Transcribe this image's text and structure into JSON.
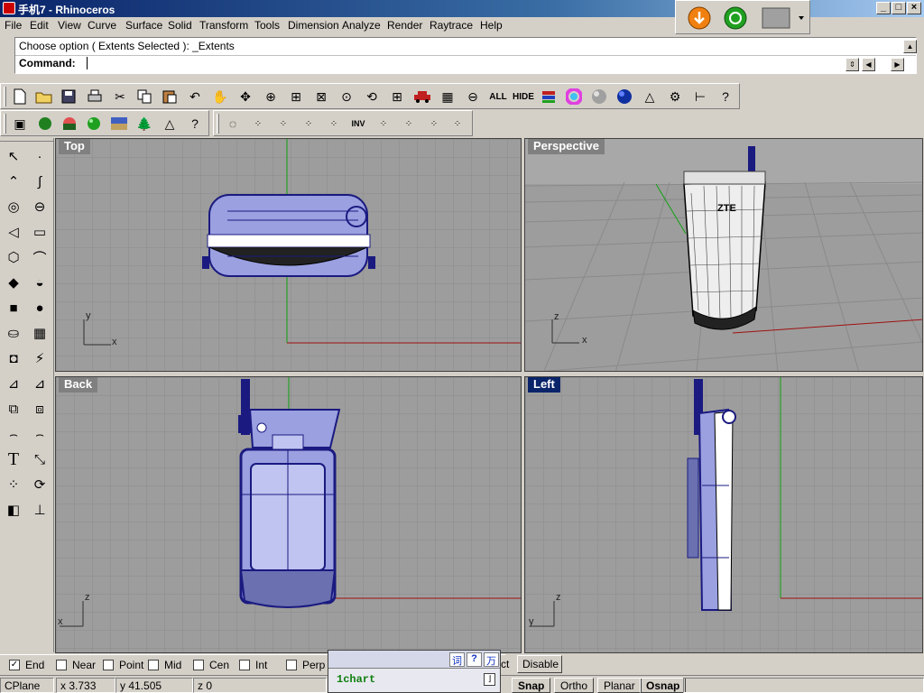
{
  "window": {
    "title": "手机7 - Rhinoceros"
  },
  "menu": [
    "File",
    "Edit",
    "View",
    "Curve",
    "Surface",
    "Solid",
    "Transform",
    "Tools",
    "Dimension",
    "Analyze",
    "Render",
    "Raytrace",
    "Help"
  ],
  "command": {
    "history": "Choose option ( Extents  Selected ): _Extents",
    "prompt": "Command:",
    "value": ""
  },
  "toolbar_main": {
    "all_label": "ALL",
    "hide_label": "HIDE"
  },
  "toolbar_select": {
    "inv_label": "INV"
  },
  "viewports": {
    "top": "Top",
    "perspective": "Perspective",
    "back": "Back",
    "left": "Left"
  },
  "axes": {
    "x": "x",
    "y": "y",
    "z": "z"
  },
  "model_text": "ZTE",
  "osnap": {
    "items": [
      {
        "label": "End",
        "checked": true
      },
      {
        "label": "Near",
        "checked": false
      },
      {
        "label": "Point",
        "checked": false
      },
      {
        "label": "Mid",
        "checked": false
      },
      {
        "label": "Cen",
        "checked": false
      },
      {
        "label": "Int",
        "checked": false
      },
      {
        "label": "Perp",
        "checked": false
      }
    ],
    "tail": "ct",
    "disable": "Disable"
  },
  "status": {
    "cplane": "CPlane",
    "x": "x 3.733",
    "y": "y 41.505",
    "z": "z 0",
    "snap": "Snap",
    "ortho": "Ortho",
    "planar": "Planar",
    "osnap": "Osnap"
  },
  "ime": {
    "b1": "词",
    "b2": "?",
    "b3": "万",
    "text": "1chart",
    "arrow": "⌋"
  },
  "colors": {
    "title_start": "#0a246a",
    "viewport_bg": "#9d9d9d",
    "grid": "#8a8a8a",
    "wire": "#1a1a80",
    "fill": "#9aa0e0",
    "x_axis": "#a01010",
    "y_axis": "#10a010"
  }
}
